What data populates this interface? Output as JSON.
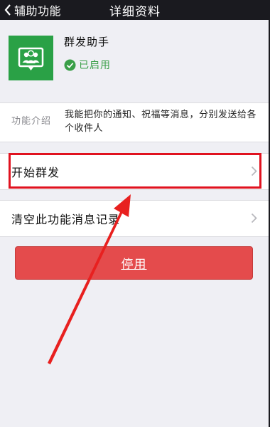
{
  "navbar": {
    "back_label": "辅助功能",
    "title": "详细资料"
  },
  "app": {
    "name": "群发助手",
    "status": "已启用",
    "icon": "group-people-icon",
    "status_icon": "check-circle-icon"
  },
  "intro": {
    "label": "功能介绍",
    "text": "我能把你的通知、祝福等消息，分别发送给各个收件人"
  },
  "list": {
    "start_label": "开始群发",
    "clear_label": "清空此功能消息记录"
  },
  "actions": {
    "stop_label": "停用"
  },
  "colors": {
    "navbar_bg": "#1a1a1f",
    "app_icon_bg": "#2aa146",
    "status_green": "#3a9f48",
    "stop_button": "#e44b4c",
    "highlight_red": "#e0121f"
  }
}
